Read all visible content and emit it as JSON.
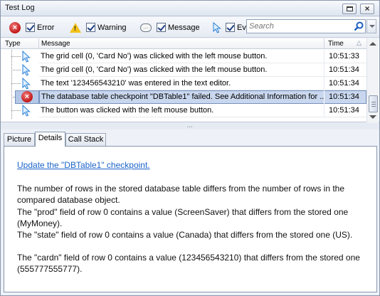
{
  "window": {
    "title": "Test Log"
  },
  "filters": [
    {
      "label": "Error",
      "checked": true,
      "icon": "error-icon"
    },
    {
      "label": "Warning",
      "checked": true,
      "icon": "warning-icon"
    },
    {
      "label": "Message",
      "checked": true,
      "icon": "message-icon"
    },
    {
      "label": "Ev",
      "checked": true,
      "icon": "event-icon"
    }
  ],
  "search": {
    "placeholder": "Search",
    "value": ""
  },
  "grid": {
    "columns": {
      "type": "Type",
      "message": "Message",
      "time": "Time"
    },
    "rows": [
      {
        "icon": "event-icon",
        "message": "The grid cell (0, 'Card No') was clicked with the left mouse button.",
        "time": "10:51:33",
        "selected": false
      },
      {
        "icon": "event-icon",
        "message": "The grid cell (0, 'Card No') was clicked with the left mouse button.",
        "time": "10:51:34",
        "selected": false
      },
      {
        "icon": "event-icon",
        "message": "The text '123456543210' was entered in the text editor.",
        "time": "10:51:34",
        "selected": false
      },
      {
        "icon": "error-icon",
        "message": "The database table checkpoint \"DBTable1\" failed. See Additional Information for ...",
        "time": "10:51:34",
        "selected": true
      },
      {
        "icon": "event-icon",
        "message": "The button was clicked with the left mouse button.",
        "time": "10:51:34",
        "selected": false
      }
    ]
  },
  "tabs": [
    {
      "label": "Picture"
    },
    {
      "label": "Details",
      "active": true
    },
    {
      "label": "Call Stack"
    }
  ],
  "details": {
    "link": "Update the \"DBTable1\" checkpoint.",
    "paragraphs": [
      "The number of rows in the stored database table differs from the number of rows in the compared database object.",
      "The \"prod\" field of row 0 contains a value (ScreenSaver) that differs from the stored one (MyMoney).",
      "The \"state\" field of row 0 contains a value (Canada) that differs from the stored one (US).",
      "The \"cardn\" field of row 0 contains a value (123456543210) that differs from the stored one (555777555777)."
    ]
  },
  "colors": {
    "accent": "#1b64c8",
    "selection": "#c9d7ee",
    "error": "#c21818"
  }
}
